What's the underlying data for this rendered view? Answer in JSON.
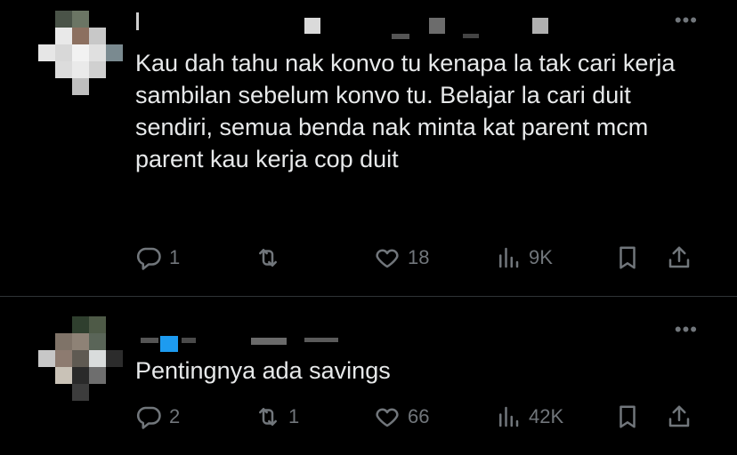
{
  "tweets": [
    {
      "text": "Kau dah tahu nak konvo tu kenapa la tak cari kerja sambilan sebelum konvo tu. Belajar la cari duit sendiri, semua benda nak minta kat parent mcm parent kau kerja cop duit",
      "more_icon": "•••",
      "replies": "1",
      "retweets": "",
      "likes": "18",
      "views": "9K"
    },
    {
      "text": "Pentingnya ada savings",
      "more_icon": "•••",
      "replies": "2",
      "retweets": "1",
      "likes": "66",
      "views": "42K"
    }
  ],
  "icons": {
    "reply": "reply-icon",
    "retweet": "retweet-icon",
    "like": "heart-icon",
    "views": "views-icon",
    "bookmark": "bookmark-icon",
    "share": "share-icon"
  },
  "colors": {
    "background": "#000000",
    "text": "#e7e9ea",
    "muted": "#71767b",
    "divider": "#2f3336",
    "accent": "#1d9bf0"
  }
}
